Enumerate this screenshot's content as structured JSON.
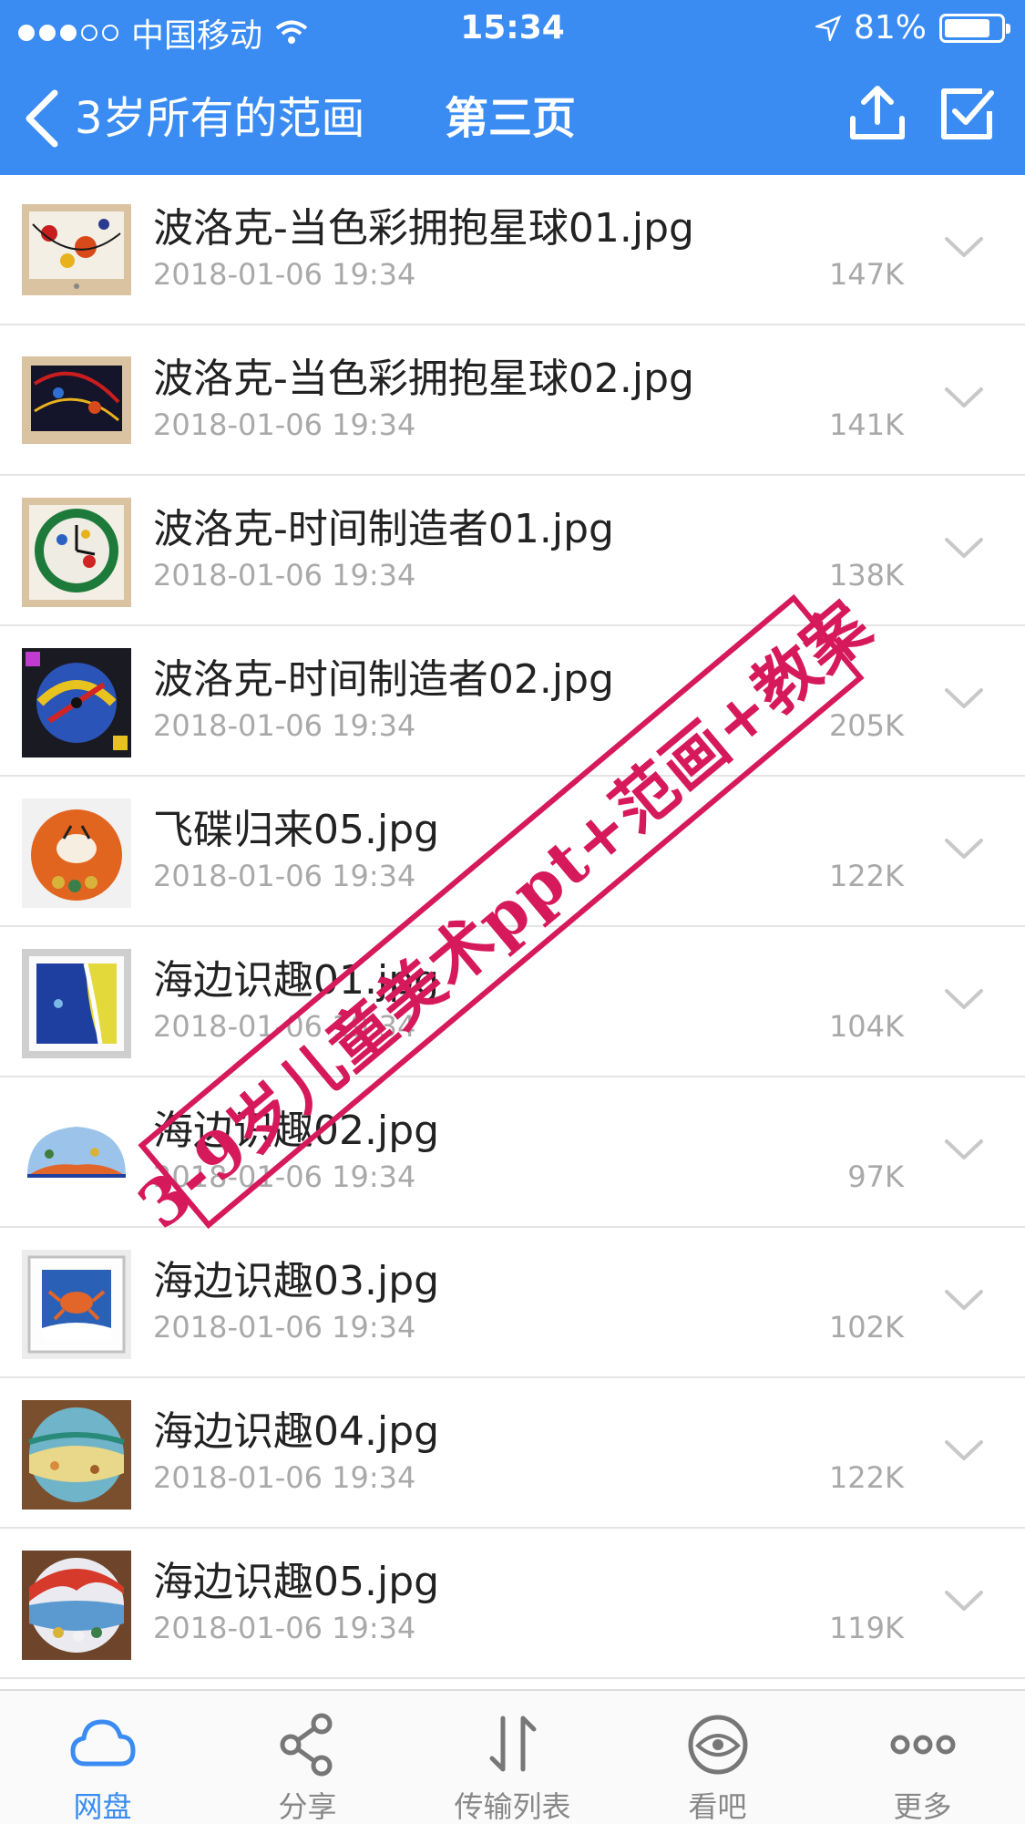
{
  "status_bar": {
    "carrier": "中国移动",
    "time": "15:34",
    "battery_text": "81%",
    "battery_level": 0.81
  },
  "nav": {
    "title": "3岁所有的范画",
    "page_label": "第三页",
    "icons": [
      "back-chevron-icon",
      "upload-icon",
      "select-checkbox-icon"
    ]
  },
  "files": [
    {
      "name": "波洛克-当色彩拥抱星球01.jpg",
      "date": "2018-01-06 19:34",
      "size": "147K"
    },
    {
      "name": "波洛克-当色彩拥抱星球02.jpg",
      "date": "2018-01-06 19:34",
      "size": "141K"
    },
    {
      "name": "波洛克-时间制造者01.jpg",
      "date": "2018-01-06 19:34",
      "size": "138K"
    },
    {
      "name": "波洛克-时间制造者02.jpg",
      "date": "2018-01-06 19:34",
      "size": "205K"
    },
    {
      "name": "飞碟归来05.jpg",
      "date": "2018-01-06 19:34",
      "size": "122K"
    },
    {
      "name": "海边识趣01.jpg",
      "date": "2018-01-06 19:34",
      "size": "104K"
    },
    {
      "name": "海边识趣02.jpg",
      "date": "2018-01-06 19:34",
      "size": "97K"
    },
    {
      "name": "海边识趣03.jpg",
      "date": "2018-01-06 19:34",
      "size": "102K"
    },
    {
      "name": "海边识趣04.jpg",
      "date": "2018-01-06 19:34",
      "size": "122K"
    },
    {
      "name": "海边识趣05.jpg",
      "date": "2018-01-06 19:34",
      "size": "119K"
    }
  ],
  "tabs": [
    {
      "label": "网盘",
      "icon": "cloud-icon",
      "active": true
    },
    {
      "label": "分享",
      "icon": "share-icon",
      "active": false
    },
    {
      "label": "传输列表",
      "icon": "transfer-icon",
      "active": false
    },
    {
      "label": "看吧",
      "icon": "eye-icon",
      "active": false
    },
    {
      "label": "更多",
      "icon": "more-icon",
      "active": false
    }
  ],
  "watermark": "3-9岁儿童美术ppt+范画+教案",
  "colors": {
    "accent": "#3a8cf2",
    "stamp": "#d6195a",
    "muted": "#a9a9a9"
  }
}
